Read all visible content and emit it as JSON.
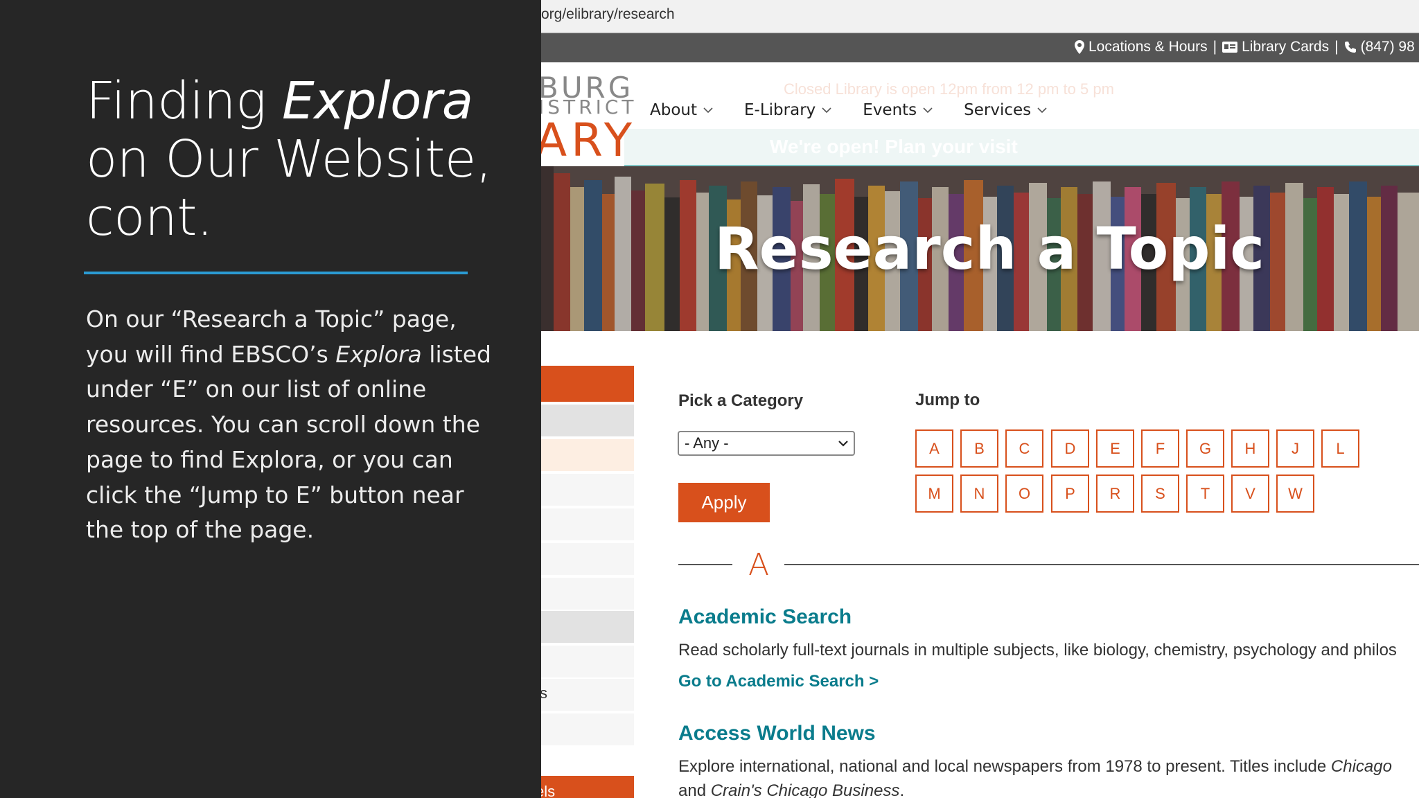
{
  "slide": {
    "title_part1": "Finding ",
    "title_italic": "Explora",
    "title_part2": "on Our Website,",
    "title_part3": "cont.",
    "body_part1": "On our “Research a Topic” page, you will find EBSCO’s ",
    "body_italic": "Explora",
    "body_part2": " listed under “E” on our list of online resources. You can scroll down the page to find Explora, or you can click the “Jump to E” button near the top of the page.",
    "accent_color": "#2b9bd3"
  },
  "browser": {
    "url": "org/elibrary/research"
  },
  "utility_bar": {
    "locations_label": "Locations & Hours",
    "locations_icon": "map-pin-icon",
    "library_cards_label": "Library Cards",
    "library_cards_icon": "id-card-icon",
    "phone_label": "(847) 98",
    "phone_icon": "phone-icon",
    "separator": "|"
  },
  "logo": {
    "line1": "BURG",
    "line2": "ISTRICT",
    "line3": "ARY",
    "accent_color": "#d8501c"
  },
  "notices": {
    "faint_hours": "Closed Library is open 12pm from 12 pm to 5 pm",
    "banner": "We're open! Plan your visit"
  },
  "nav": {
    "items": [
      {
        "label": "About"
      },
      {
        "label": "E-Library"
      },
      {
        "label": "Events"
      },
      {
        "label": "Services"
      }
    ]
  },
  "hero": {
    "title": "Research a Topic"
  },
  "filters": {
    "category_label": "Pick a Category",
    "category_value": "- Any -",
    "apply_label": "Apply",
    "jump_label": "Jump to",
    "letters_row1": [
      "A",
      "B",
      "C",
      "D",
      "E",
      "F",
      "G",
      "H",
      "J",
      "L"
    ],
    "letters_row2": [
      "M",
      "N",
      "O",
      "P",
      "R",
      "S",
      "T",
      "V",
      "W"
    ]
  },
  "section": {
    "letter": "A"
  },
  "resources": [
    {
      "title": "Academic Search",
      "description": "Read scholarly full-text journals in multiple subjects, like biology, chemistry, psychology and philos",
      "link": "Go to Academic Search >"
    },
    {
      "title": "Access World News",
      "description": "Explore international, national and local newspapers from 1978 to present. Titles include ",
      "description_italic": "Chicago",
      "description_line2_pre": "and ",
      "description_line2_italic": "Crain's Chicago Business",
      "description_line2_post": "."
    }
  ],
  "sidebar": {
    "partial_text_1": "s",
    "partial_text_2": "els"
  },
  "colors": {
    "brand_orange": "#d8501c",
    "link_teal": "#0a7c8c",
    "slide_bg": "#262626"
  }
}
